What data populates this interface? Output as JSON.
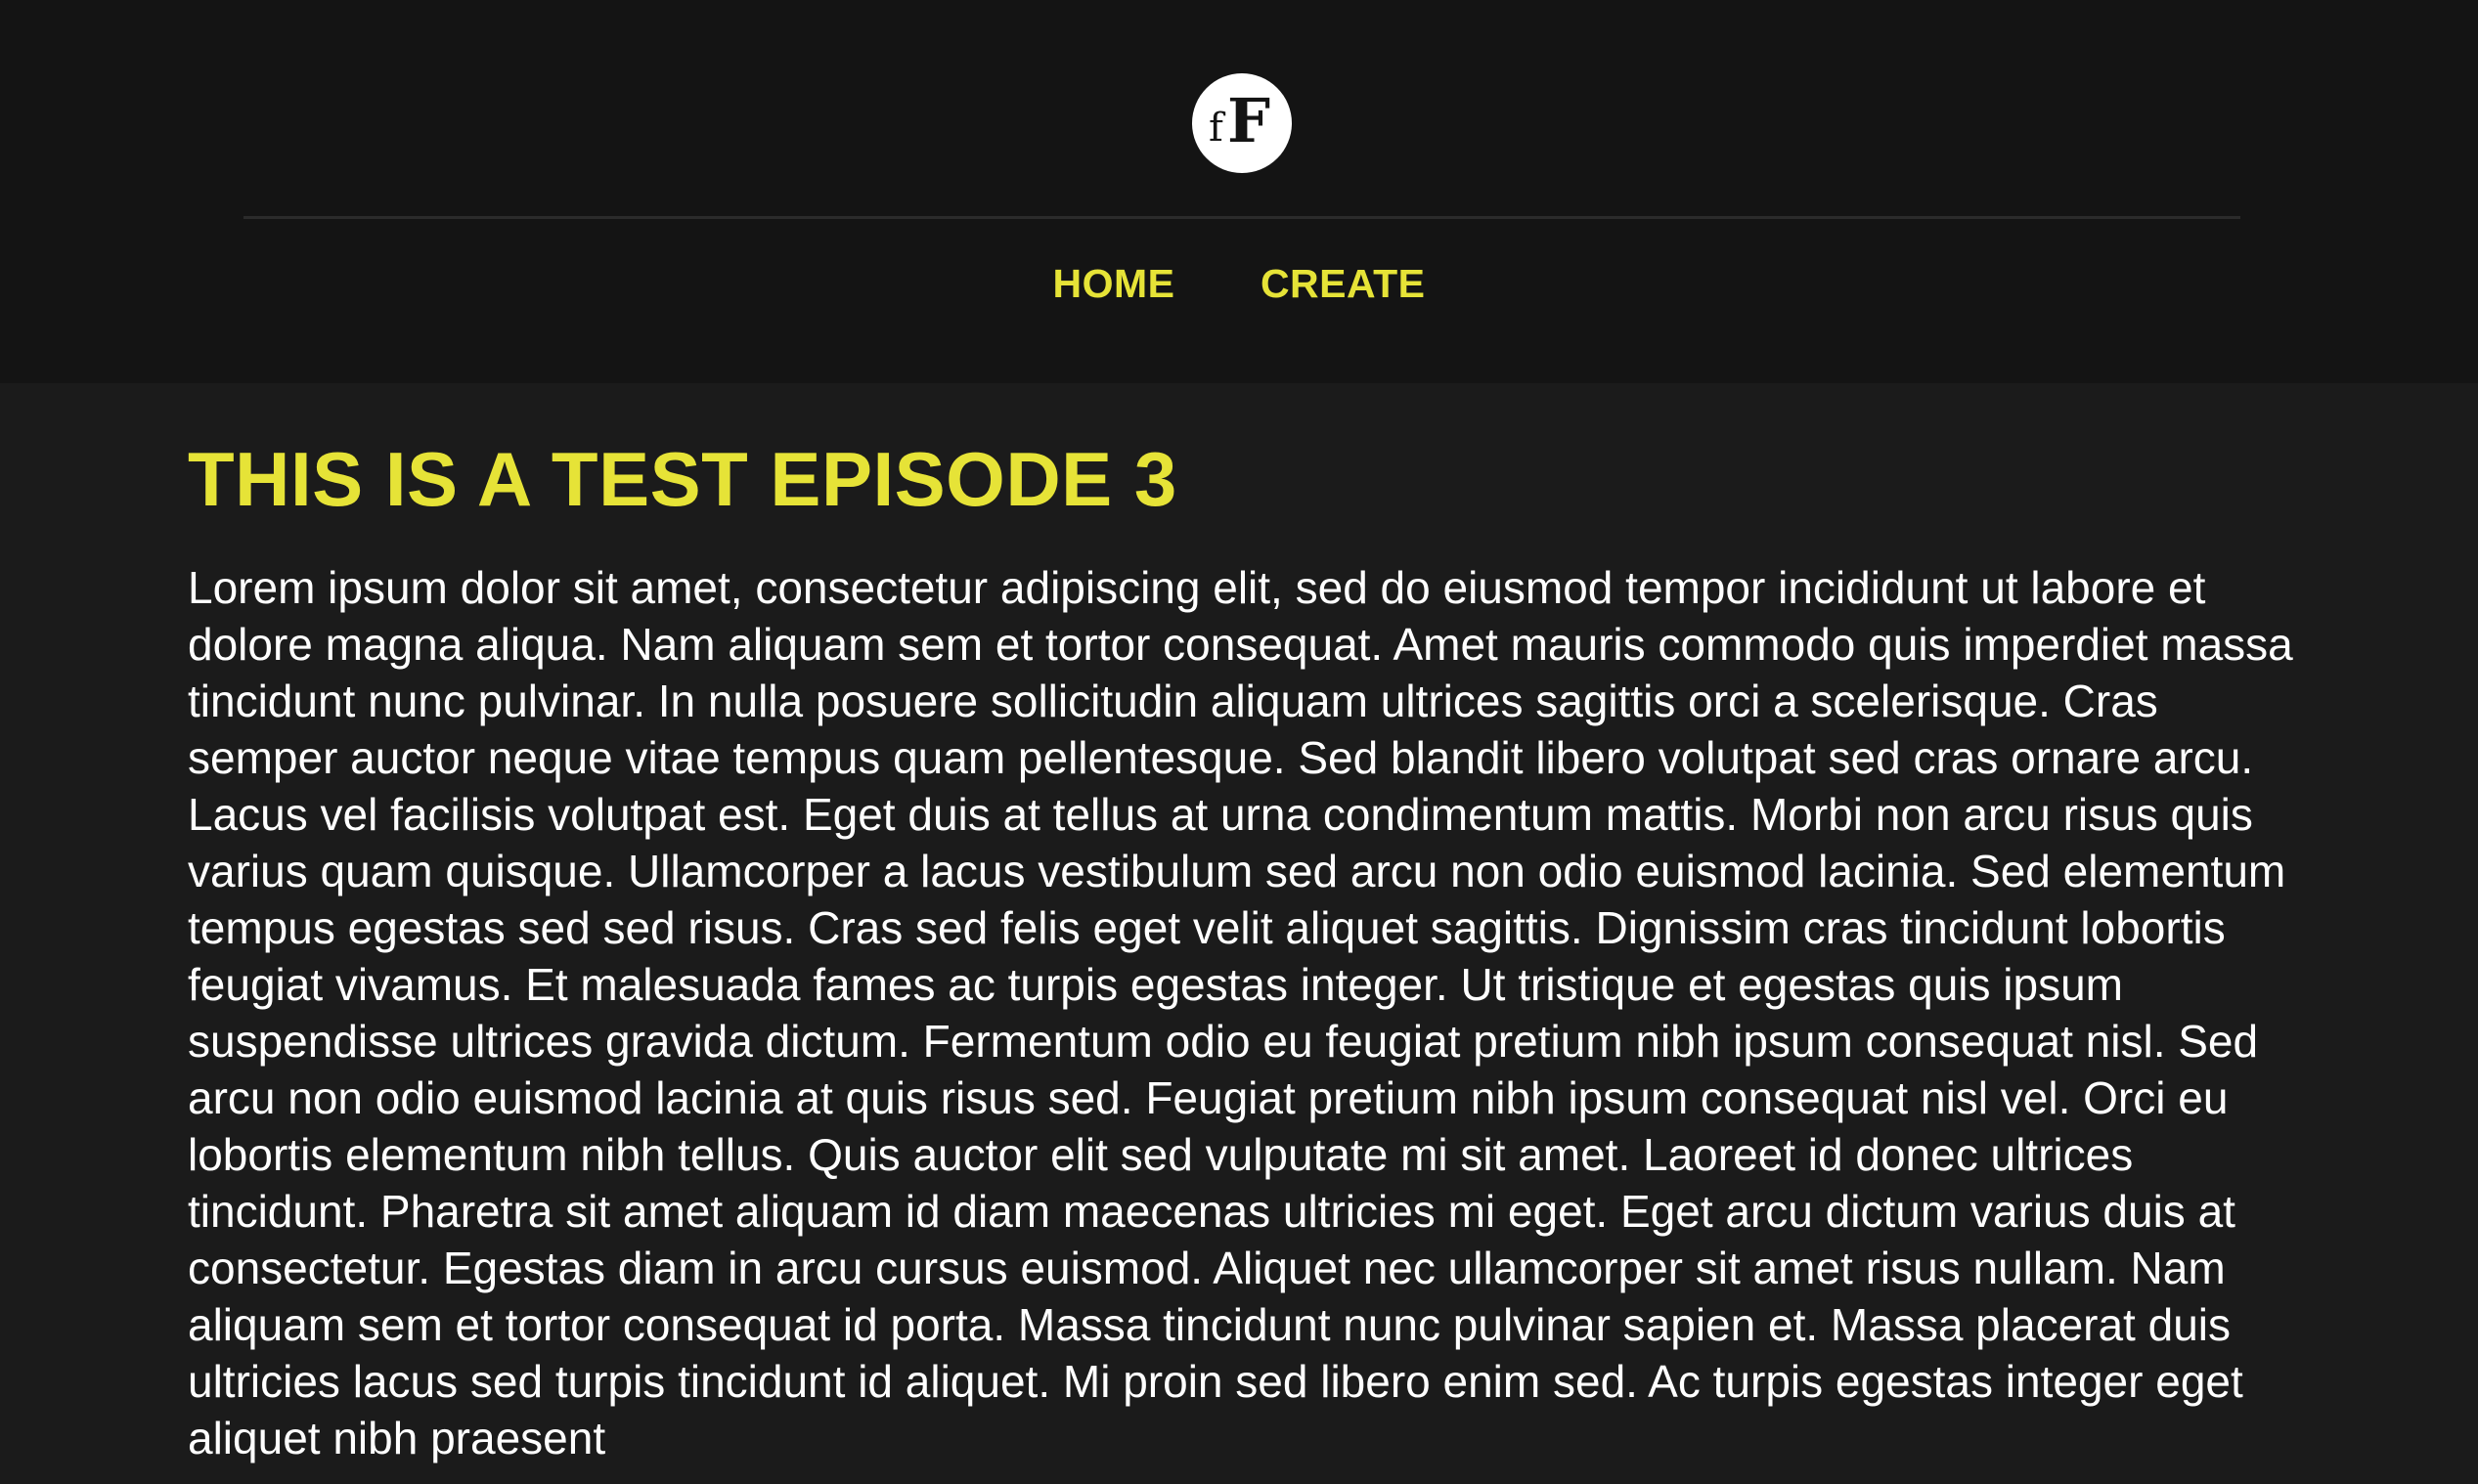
{
  "header": {
    "logo": {
      "small_letter": "f",
      "big_letter": "F"
    },
    "nav": {
      "home": "HOME",
      "create": "CREATE"
    }
  },
  "episode": {
    "title": "THIS IS A TEST EPISODE 3",
    "body": "Lorem ipsum dolor sit amet, consectetur adipiscing elit, sed do eiusmod tempor incididunt ut labore et dolore magna aliqua. Nam aliquam sem et tortor consequat. Amet mauris commodo quis imperdiet massa tincidunt nunc pulvinar. In nulla posuere sollicitudin aliquam ultrices sagittis orci a scelerisque. Cras semper auctor neque vitae tempus quam pellentesque. Sed blandit libero volutpat sed cras ornare arcu. Lacus vel facilisis volutpat est. Eget duis at tellus at urna condimentum mattis. Morbi non arcu risus quis varius quam quisque. Ullamcorper a lacus vestibulum sed arcu non odio euismod lacinia. Sed elementum tempus egestas sed sed risus. Cras sed felis eget velit aliquet sagittis. Dignissim cras tincidunt lobortis feugiat vivamus. Et malesuada fames ac turpis egestas integer. Ut tristique et egestas quis ipsum suspendisse ultrices gravida dictum. Fermentum odio eu feugiat pretium nibh ipsum consequat nisl. Sed arcu non odio euismod lacinia at quis risus sed. Feugiat pretium nibh ipsum consequat nisl vel. Orci eu lobortis elementum nibh tellus. Quis auctor elit sed vulputate mi sit amet. Laoreet id donec ultrices tincidunt. Pharetra sit amet aliquam id diam maecenas ultricies mi eget. Eget arcu dictum varius duis at consectetur. Egestas diam in arcu cursus euismod. Aliquet nec ullamcorper sit amet risus nullam. Nam aliquam sem et tortor consequat id porta. Massa tincidunt nunc pulvinar sapien et. Massa placerat duis ultricies lacus sed turpis tincidunt id aliquet. Mi proin sed libero enim sed. Ac turpis egestas integer eget aliquet nibh praesent"
  },
  "colors": {
    "accent": "#e6e337",
    "header_bg": "#141414",
    "page_bg": "#1b1b1b",
    "text": "#ffffff"
  }
}
